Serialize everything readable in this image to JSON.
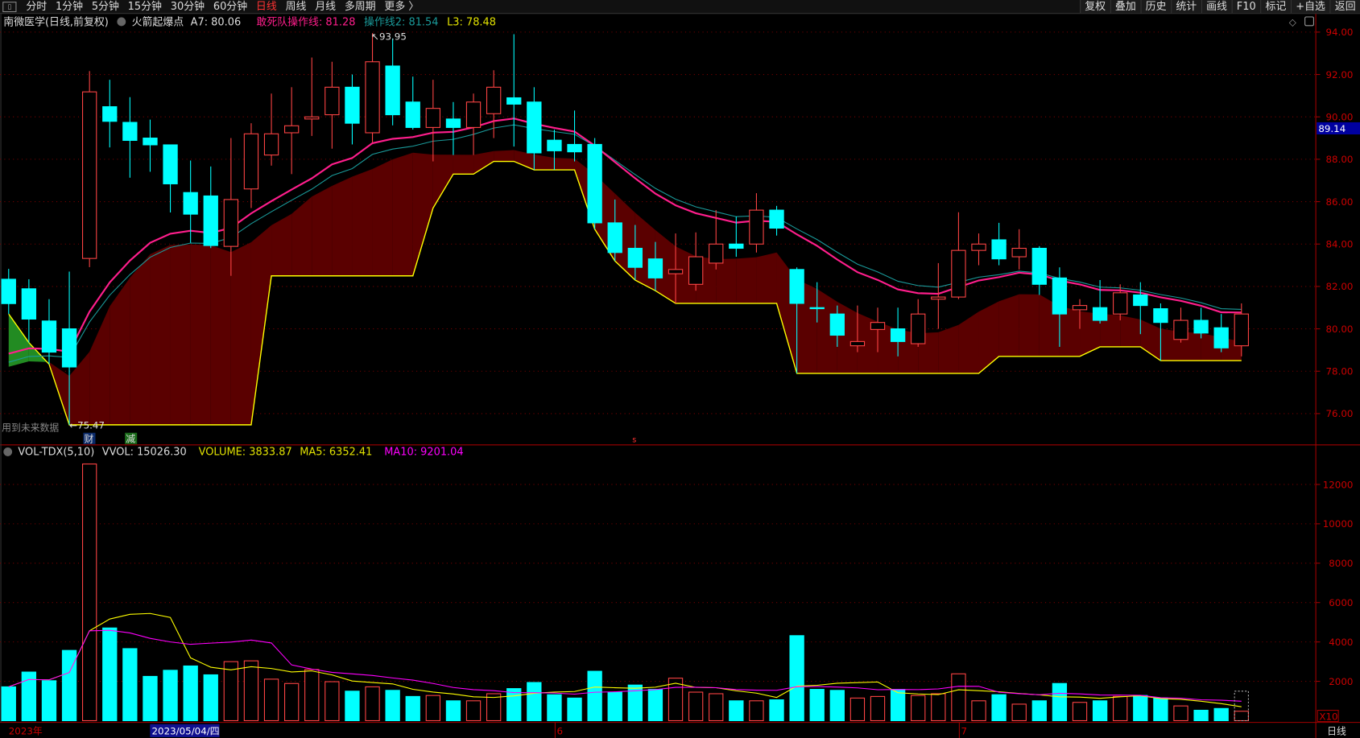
{
  "topbar": {
    "app_icon": "window-icon",
    "tabs": [
      "分时",
      "1分钟",
      "5分钟",
      "15分钟",
      "30分钟",
      "60分钟",
      "日线",
      "周线",
      "月线",
      "多周期",
      "更多 〉"
    ],
    "active_tab": "日线",
    "right_buttons": [
      "复权",
      "叠加",
      "历史",
      "统计",
      "画线",
      "F10",
      "标记",
      "+自选",
      "返回"
    ]
  },
  "info": {
    "title": "南微医学(日线,前复权)",
    "indicator_name": "火箭起爆点",
    "a7": "A7: 80.06",
    "line1": "敢死队操作线: 81.28",
    "line2": "操作线2: 81.54",
    "l3": "L3: 78.48"
  },
  "volume_info": {
    "name": "VOL-TDX(5,10)",
    "vvol": "VVOL: 15026.30",
    "volume": "VOLUME: 3833.87",
    "ma5": "MA5: 6352.41",
    "ma10": "MA10: 9201.04"
  },
  "annotations": {
    "high_label": "93.95",
    "low_label": "75.47",
    "future_data_note": "用到未来数据",
    "marker_cai": "财",
    "marker_jian": "减",
    "marker_s": "s",
    "current_price": "89.14",
    "vol_scale": "X10"
  },
  "xaxis": {
    "year": "2023年",
    "cursor_date": "2023/05/04/四",
    "month6": "6",
    "month7": "7",
    "period": "日线"
  },
  "colors": {
    "up": "#ff4444",
    "down": "#00ffff",
    "line1": "#ff1e8c",
    "line2": "#1a9a9a",
    "l3": "#ffff00",
    "fill_red": "#5a0000",
    "fill_green": "#228b22",
    "ma5": "#ffff00",
    "ma10": "#ff00ff",
    "axis": "#a00000",
    "current_price_bg": "#0000a0"
  },
  "chart_data": {
    "type": "candlestick",
    "price_ticks": [
      "94.00",
      "92.00",
      "90.00",
      "88.00",
      "86.00",
      "84.00",
      "82.00",
      "80.00",
      "78.00",
      "76.00"
    ],
    "price_range": [
      75.4,
      94.6
    ],
    "volume_ticks": [
      "12000",
      "10000",
      "8000",
      "6000",
      "4000",
      "2000"
    ],
    "volume_range": [
      0,
      13200
    ],
    "grid": true,
    "candles_ohlc": [
      [
        82.34,
        82.83,
        80.7,
        81.19
      ],
      [
        81.89,
        82.34,
        79.35,
        80.46
      ],
      [
        80.37,
        81.4,
        78.33,
        78.9
      ],
      [
        80.0,
        82.7,
        75.47,
        78.2
      ],
      [
        83.32,
        92.16,
        82.91,
        91.18
      ],
      [
        90.48,
        91.75,
        88.56,
        89.79
      ],
      [
        89.74,
        90.93,
        87.13,
        88.89
      ],
      [
        89.0,
        89.87,
        87.41,
        88.68
      ],
      [
        88.68,
        88.68,
        85.49,
        86.84
      ],
      [
        86.43,
        87.94,
        84.06,
        85.41
      ],
      [
        86.27,
        87.66,
        83.81,
        83.93
      ],
      [
        83.89,
        89.0,
        82.5,
        86.1
      ],
      [
        86.6,
        89.7,
        85.7,
        89.2
      ],
      [
        88.2,
        91.1,
        87.7,
        89.2
      ],
      [
        89.25,
        91.4,
        87.3,
        89.58
      ],
      [
        89.9,
        92.8,
        89.1,
        90.0
      ],
      [
        90.1,
        92.6,
        88.5,
        91.4
      ],
      [
        91.4,
        92.0,
        88.7,
        89.7
      ],
      [
        89.25,
        93.95,
        88.8,
        92.6
      ],
      [
        92.4,
        93.7,
        89.6,
        90.1
      ],
      [
        90.7,
        91.9,
        89.4,
        89.5
      ],
      [
        89.5,
        91.75,
        87.9,
        90.4
      ],
      [
        89.9,
        90.7,
        88.2,
        89.5
      ],
      [
        89.5,
        91.1,
        88.2,
        90.7
      ],
      [
        90.15,
        92.2,
        89.0,
        91.4
      ],
      [
        90.9,
        93.9,
        88.6,
        90.6
      ],
      [
        90.7,
        91.4,
        87.5,
        88.3
      ],
      [
        88.9,
        89.4,
        87.5,
        88.4
      ],
      [
        88.7,
        90.3,
        87.9,
        88.35
      ],
      [
        88.7,
        89.0,
        84.7,
        85.0
      ],
      [
        85.0,
        86.1,
        83.2,
        83.6
      ],
      [
        83.8,
        84.9,
        82.3,
        82.9
      ],
      [
        83.3,
        84.1,
        81.8,
        82.4
      ],
      [
        82.6,
        84.5,
        81.2,
        82.8
      ],
      [
        82.1,
        84.55,
        81.8,
        83.4
      ],
      [
        83.1,
        85.6,
        82.8,
        84.0
      ],
      [
        84.0,
        85.3,
        83.4,
        83.8
      ],
      [
        84.0,
        86.4,
        83.6,
        85.6
      ],
      [
        85.6,
        85.8,
        84.4,
        84.75
      ],
      [
        82.8,
        82.9,
        77.9,
        81.2
      ],
      [
        81.0,
        82.2,
        80.3,
        80.95
      ],
      [
        80.7,
        81.1,
        79.15,
        79.7
      ],
      [
        79.2,
        81.1,
        78.9,
        79.4
      ],
      [
        79.97,
        81.0,
        78.9,
        80.3
      ],
      [
        80.0,
        81.0,
        78.7,
        79.4
      ],
      [
        79.3,
        81.4,
        79.15,
        80.7
      ],
      [
        81.4,
        83.1,
        80.0,
        81.5
      ],
      [
        81.5,
        85.5,
        81.4,
        83.7
      ],
      [
        83.7,
        84.5,
        83.0,
        84.0
      ],
      [
        84.2,
        85.0,
        83.0,
        83.3
      ],
      [
        83.4,
        84.7,
        82.8,
        83.8
      ],
      [
        83.8,
        83.9,
        81.6,
        82.1
      ],
      [
        82.4,
        82.9,
        79.15,
        80.7
      ],
      [
        80.9,
        81.4,
        80.0,
        81.1
      ],
      [
        81.0,
        82.3,
        80.25,
        80.4
      ],
      [
        80.7,
        82.1,
        80.4,
        81.7
      ],
      [
        81.6,
        82.2,
        79.75,
        81.1
      ],
      [
        80.95,
        81.2,
        78.5,
        80.3
      ],
      [
        79.5,
        81.0,
        79.35,
        80.4
      ],
      [
        80.4,
        81.0,
        79.55,
        79.8
      ],
      [
        80.05,
        80.7,
        78.9,
        79.1
      ],
      [
        79.2,
        81.2,
        78.7,
        80.7
      ]
    ],
    "volumes": [
      1720,
      2470,
      2030,
      3570,
      13040,
      4710,
      3660,
      2250,
      2560,
      2780,
      2330,
      3000,
      3040,
      2110,
      1890,
      2600,
      1980,
      1500,
      1720,
      1540,
      1230,
      1280,
      1010,
      1010,
      1370,
      1630,
      1940,
      1320,
      1150,
      2510,
      1450,
      1810,
      1590,
      2160,
      1450,
      1370,
      1010,
      1010,
      1060,
      4320,
      1590,
      1540,
      1150,
      1230,
      1590,
      1280,
      1370,
      2380,
      1010,
      1320,
      840,
      1010,
      1890,
      930,
      1010,
      1230,
      1280,
      1150,
      750,
      530,
      620,
      480
    ]
  }
}
